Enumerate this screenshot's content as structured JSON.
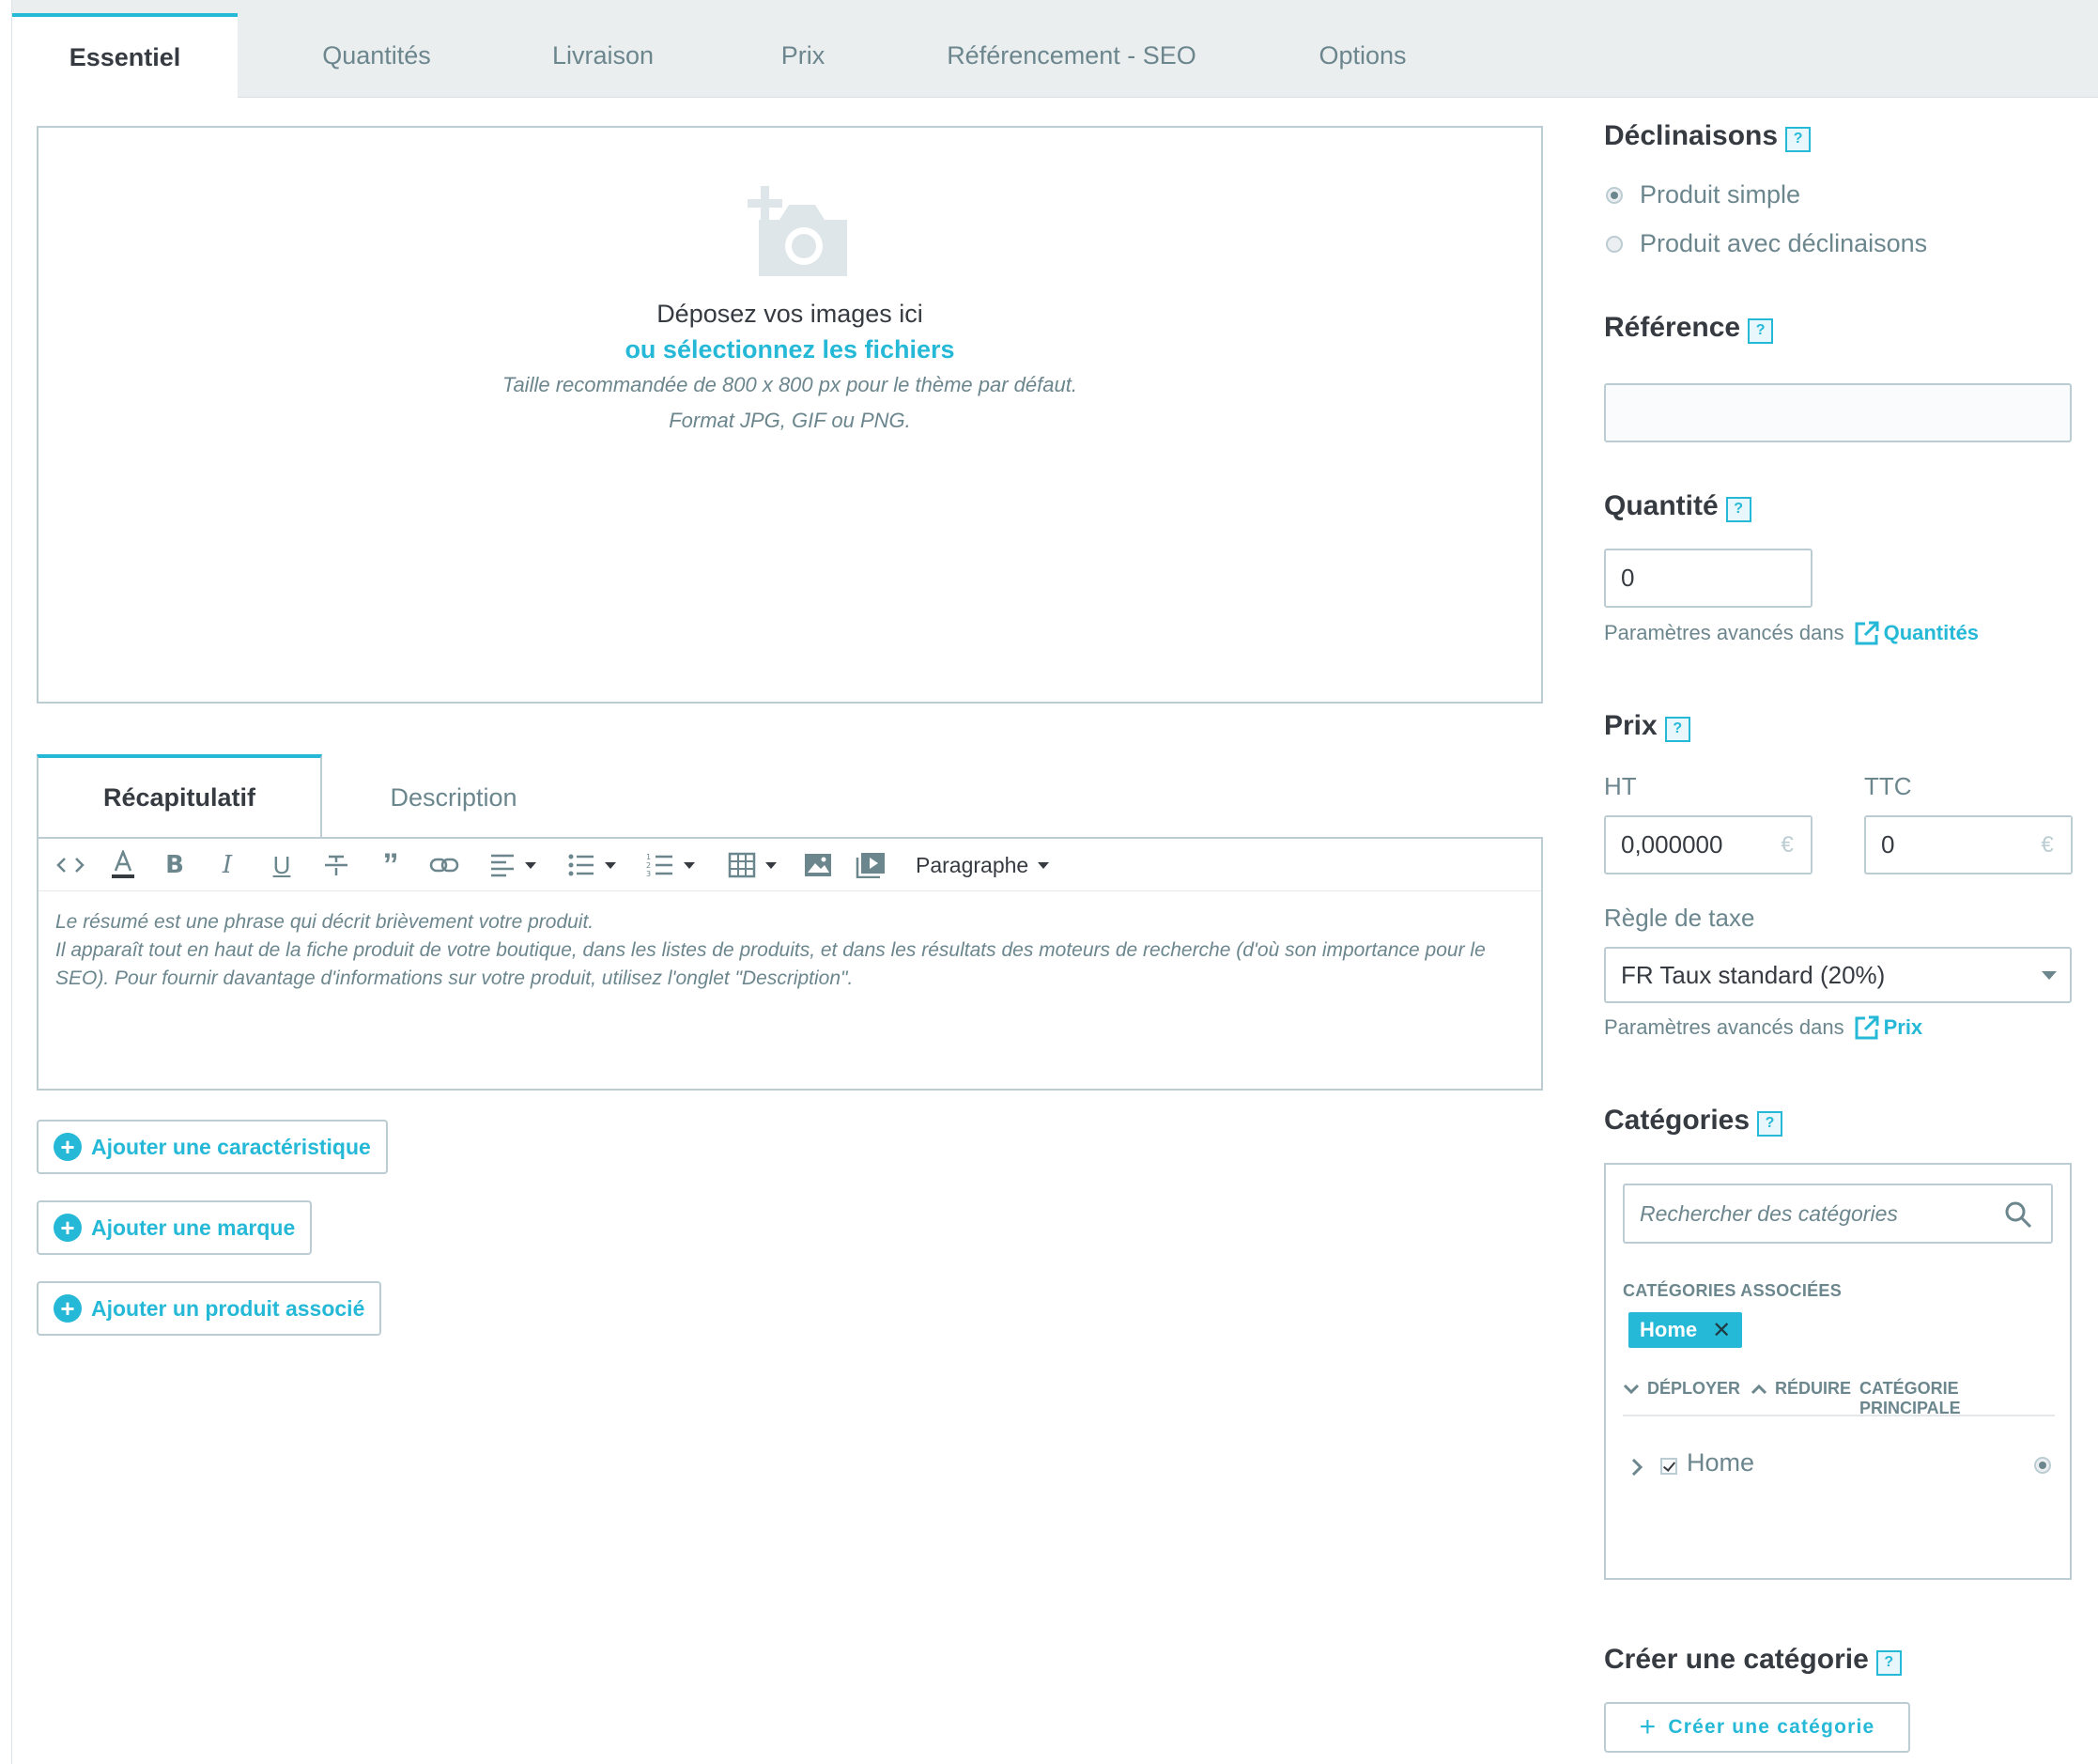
{
  "tabs": [
    {
      "label": "Essentiel"
    },
    {
      "label": "Quantités"
    },
    {
      "label": "Livraison"
    },
    {
      "label": "Prix"
    },
    {
      "label": "Référencement - SEO"
    },
    {
      "label": "Options"
    }
  ],
  "dropzone": {
    "title": "Déposez vos images ici",
    "select_link": "ou sélectionnez les fichiers",
    "hint_size": "Taille recommandée de 800 x 800 px pour le thème par défaut.",
    "hint_format": "Format JPG, GIF ou PNG.",
    "icon": "camera-add-icon"
  },
  "summary_tabs": [
    {
      "label": "Récapitulatif"
    },
    {
      "label": "Description"
    }
  ],
  "editor": {
    "format_label": "Paragraphe",
    "text_line1": "Le résumé est une phrase qui décrit brièvement votre produit.",
    "text_line2": "Il apparaît tout en haut de la fiche produit de votre boutique, dans les listes de produits, et dans les résultats des moteurs de recherche (d'où son importance pour le SEO). Pour fournir davantage d'informations sur votre produit, utilisez l'onglet \"Description\"."
  },
  "add_buttons": [
    {
      "label": "Ajouter une caractéristique"
    },
    {
      "label": "Ajouter une marque"
    },
    {
      "label": "Ajouter un produit associé"
    }
  ],
  "declinaisons": {
    "title": "Déclinaisons",
    "option_simple": "Produit simple",
    "option_variants": "Produit avec déclinaisons",
    "selected": "Produit simple"
  },
  "reference": {
    "title": "Référence",
    "value": ""
  },
  "quantite": {
    "title": "Quantité",
    "value": "0",
    "adv_text": "Paramètres avancés dans",
    "adv_link": "Quantités"
  },
  "prix": {
    "title": "Prix",
    "ht_label": "HT",
    "ttc_label": "TTC",
    "ht_value": "0,000000",
    "ttc_value": "0",
    "currency": "€",
    "tax_label": "Règle de taxe",
    "tax_value": "FR Taux standard (20%)",
    "adv_text": "Paramètres avancés dans",
    "adv_link": "Prix"
  },
  "categories": {
    "title": "Catégories",
    "search_placeholder": "Rechercher des catégories",
    "assoc_label": "CATÉGORIES ASSOCIÉES",
    "chip": "Home",
    "expand": "DÉPLOYER",
    "collapse": "RÉDUIRE",
    "main": "CATÉGORIE PRINCIPALE",
    "tree_item": "Home"
  },
  "create_category": {
    "title": "Créer une catégorie",
    "button": "Créer une catégorie"
  },
  "help_glyph": "?",
  "colors": {
    "accent": "#25b9d7",
    "text": "#363a41",
    "muted": "#6c868e",
    "border": "#bbcdd2"
  }
}
